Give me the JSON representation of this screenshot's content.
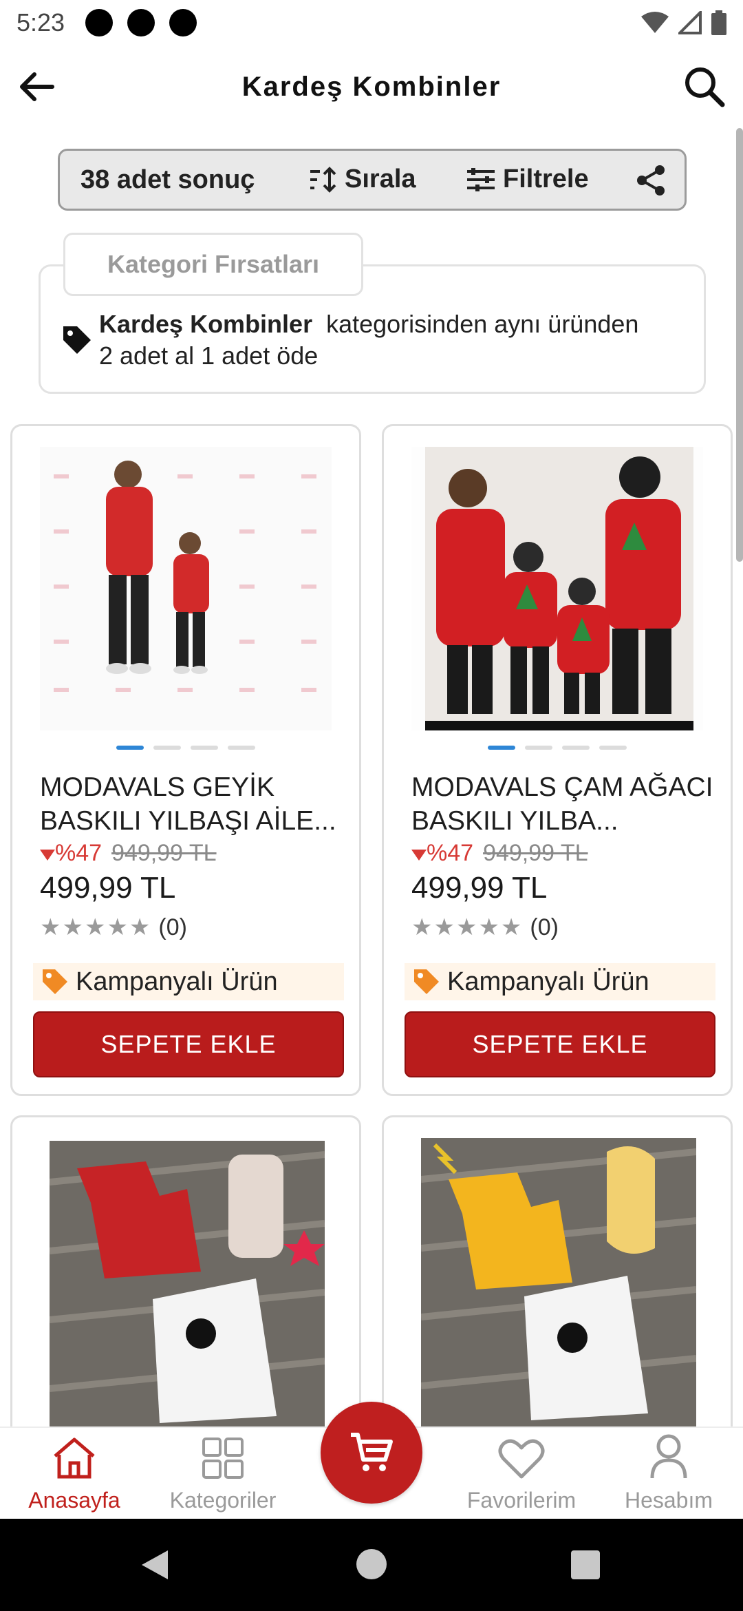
{
  "status_bar": {
    "time": "5:23"
  },
  "header": {
    "title": "Kardeş Kombinler"
  },
  "toolbar": {
    "result_count": "38 adet sonuç",
    "sort_label": "Sırala",
    "filter_label": "Filtrele"
  },
  "campaign": {
    "tab_label": "Kategori Fırsatları",
    "category_name": "Kardeş Kombinler",
    "text_part1": "kategorisinden aynı üründen",
    "text_part2": "2 adet al 1 adet öde"
  },
  "products": [
    {
      "name": "MODAVALS GEYİK BASKILI YILBAŞI AİLE...",
      "discount": "%47",
      "old_price": "949,99 TL",
      "price": "499,99 TL",
      "rating_count": "(0)",
      "badge": "Kampanyalı Ürün",
      "button": "SEPETE EKLE"
    },
    {
      "name": "MODAVALS ÇAM AĞACI BASKILI YILBA...",
      "discount": "%47",
      "old_price": "949,99 TL",
      "price": "499,99 TL",
      "rating_count": "(0)",
      "badge": "Kampanyalı Ürün",
      "button": "SEPETE EKLE"
    }
  ],
  "bottom_nav": {
    "home": "Anasayfa",
    "categories": "Kategoriler",
    "favorites": "Favorilerim",
    "account": "Hesabım"
  },
  "colors": {
    "brand_red": "#b91c1c",
    "discount_red": "#d73a35",
    "badge_orange": "#f08a24",
    "dot_active": "#2e86d6"
  },
  "icons": [
    "arrow-left-icon",
    "search-icon",
    "sort-icon",
    "filter-icon",
    "share-icon",
    "tag-icon",
    "home-icon",
    "grid-icon",
    "cart-icon",
    "heart-icon",
    "user-icon"
  ]
}
